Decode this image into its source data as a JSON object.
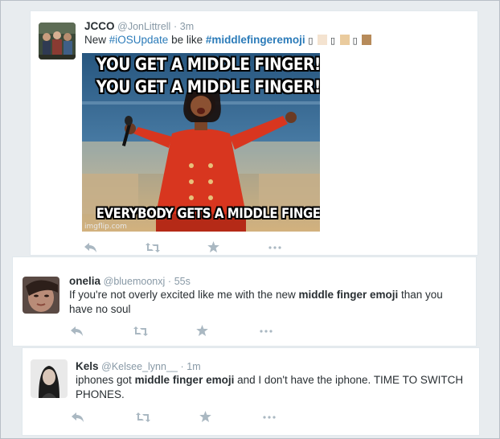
{
  "tweets": [
    {
      "name": "JCCO",
      "handle": "@JonLittrell",
      "separator": "·",
      "time": "3m",
      "text_before": "New ",
      "hashtag_1": "#iOSUpdate",
      "text_middle": " be like ",
      "hashtag_2": "#middlefingeremoji",
      "emoji_placeholder": "▯",
      "skin_tone_colors": [
        "#f4e3d0",
        "#eacb9e",
        "#b78b5a"
      ],
      "media": {
        "caption_top_1": "YOU GET A MIDDLE FINGER!",
        "caption_top_2": "YOU GET A MIDDLE FINGER!",
        "caption_bottom": "EVERYBODY GETS A MIDDLE FINGER!!",
        "watermark": "imgflip.com"
      }
    },
    {
      "name": "onelia",
      "handle": "@bluemoonxj",
      "separator": "·",
      "time": "55s",
      "text_1": "If you're not overly excited like me with the new ",
      "bold": "middle finger emoji",
      "text_2": " than you",
      "text_3": "have no soul"
    },
    {
      "name": "Kels",
      "handle": "@Kelsee_lynn__",
      "separator": "·",
      "time": "1m",
      "text_1": "iphones got ",
      "bold": "middle finger emoji",
      "text_2": " and I don't have the iphone. TIME TO SWITCH",
      "text_3": "PHONES."
    }
  ],
  "actions": [
    "reply-icon",
    "retweet-icon",
    "favorite-icon",
    "more-icon"
  ],
  "colors": {
    "link": "#2b7bb9",
    "meta": "#8899a6",
    "icon": "#aab8c2",
    "text": "#292f33"
  }
}
